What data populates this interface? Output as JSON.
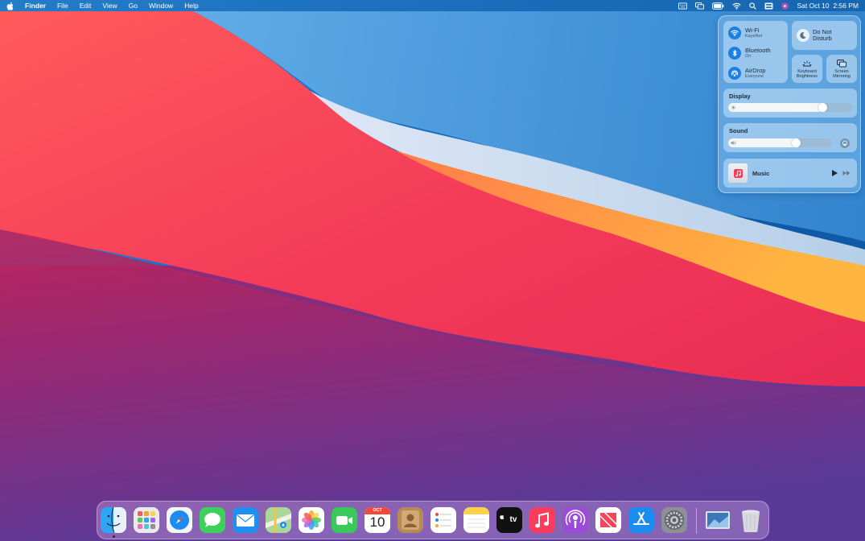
{
  "menubar": {
    "apple_icon": "apple-logo-icon",
    "app_name": "Finder",
    "menus": [
      "File",
      "Edit",
      "View",
      "Go",
      "Window",
      "Help"
    ],
    "status_icons": [
      "keyboard-layout-icon",
      "screen-mirroring-icon",
      "battery-icon",
      "wifi-icon",
      "spotlight-search-icon",
      "control-center-icon",
      "siri-icon"
    ],
    "clock": "Sat Oct 10  2:56 PM"
  },
  "control_center": {
    "wifi": {
      "title": "Wi-Fi",
      "subtitle": "KayeNet",
      "icon": "wifi-icon"
    },
    "bluetooth": {
      "title": "Bluetooth",
      "subtitle": "On",
      "icon": "bluetooth-icon"
    },
    "airdrop": {
      "title": "AirDrop",
      "subtitle": "Everyone",
      "icon": "airdrop-icon"
    },
    "do_not_disturb": {
      "line1": "Do Not",
      "line2": "Disturb",
      "icon": "moon-icon"
    },
    "keyboard_brightness": {
      "line1": "Keyboard",
      "line2": "Brightness",
      "icon": "keyboard-brightness-icon"
    },
    "screen_mirroring": {
      "line1": "Screen",
      "line2": "Mirroring",
      "icon": "screen-mirroring-icon"
    },
    "display": {
      "title": "Display",
      "level": 0.8
    },
    "sound": {
      "title": "Sound",
      "level": 0.7
    },
    "music": {
      "title": "Music"
    }
  },
  "dock": {
    "apps": [
      {
        "name": "finder",
        "running": true
      },
      {
        "name": "launchpad"
      },
      {
        "name": "safari"
      },
      {
        "name": "messages"
      },
      {
        "name": "mail"
      },
      {
        "name": "maps"
      },
      {
        "name": "photos"
      },
      {
        "name": "facetime"
      },
      {
        "name": "calendar",
        "month": "OCT",
        "day": "10"
      },
      {
        "name": "contacts"
      },
      {
        "name": "reminders"
      },
      {
        "name": "notes"
      },
      {
        "name": "apple-tv",
        "label": "tv"
      },
      {
        "name": "music"
      },
      {
        "name": "podcasts"
      },
      {
        "name": "news"
      },
      {
        "name": "app-store"
      },
      {
        "name": "system-preferences"
      }
    ],
    "others": [
      {
        "name": "downloads-folder"
      },
      {
        "name": "trash"
      }
    ]
  },
  "colors": {
    "menubar": "#1e6eb4",
    "accent": "#1a7fe6"
  }
}
